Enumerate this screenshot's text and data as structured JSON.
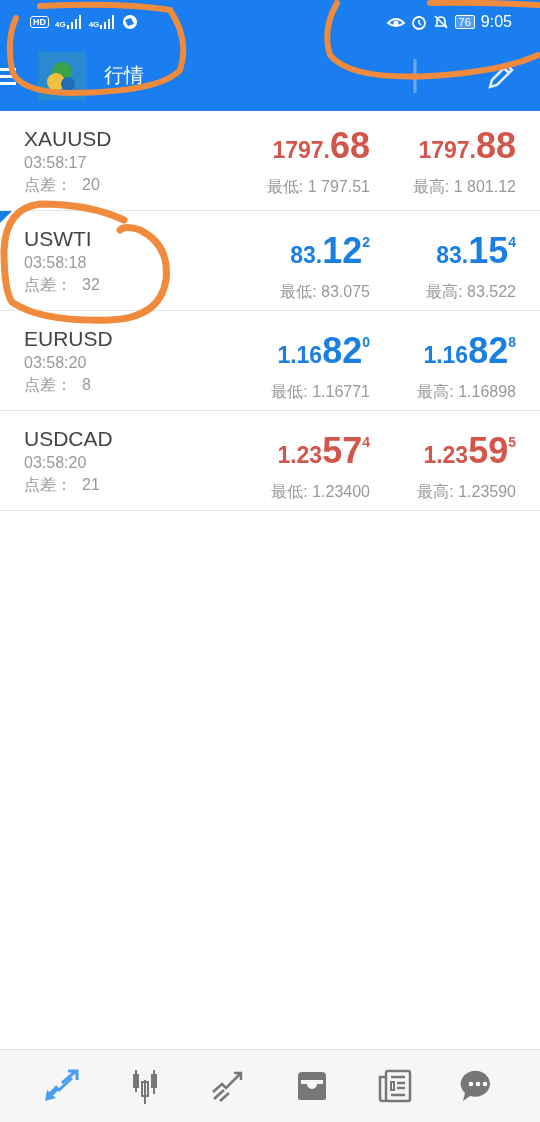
{
  "status_bar": {
    "hd_label": "HD",
    "networks": [
      "4G",
      "4G"
    ],
    "battery": "76",
    "time": "9:05"
  },
  "toolbar": {
    "title": "行情"
  },
  "quotes": [
    {
      "symbol": "XAUUSD",
      "time": "03:58:17",
      "spread_label": "点差：",
      "spread": "20",
      "color": "#d2574a",
      "selected": false,
      "bid": {
        "head": "1797.",
        "big": "68"
      },
      "ask": {
        "head": "1797.",
        "big": "88"
      },
      "low": "最低: 1 797.51",
      "high": "最高: 1 801.12"
    },
    {
      "symbol": "USWTI",
      "time": "03:58:18",
      "spread_label": "点差：",
      "spread": "32",
      "color": "#1a7fe3",
      "selected": true,
      "bid": {
        "head": "83.",
        "big": "12",
        "tail": "2"
      },
      "ask": {
        "head": "83.",
        "big": "15",
        "tail": "4"
      },
      "low": "最低: 83.075",
      "high": "最高: 83.522"
    },
    {
      "symbol": "EURUSD",
      "time": "03:58:20",
      "spread_label": "点差：",
      "spread": "8",
      "color": "#1a7fe3",
      "selected": false,
      "bid": {
        "head": "1.16",
        "big": "82",
        "tail": "0"
      },
      "ask": {
        "head": "1.16",
        "big": "82",
        "tail": "8"
      },
      "low": "最低: 1.16771",
      "high": "最高: 1.16898"
    },
    {
      "symbol": "USDCAD",
      "time": "03:58:20",
      "spread_label": "点差：",
      "spread": "21",
      "color": "#d2574a",
      "selected": false,
      "bid": {
        "head": "1.23",
        "big": "57",
        "tail": "4"
      },
      "ask": {
        "head": "1.23",
        "big": "59",
        "tail": "5"
      },
      "low": "最低: 1.23400",
      "high": "最高: 1.23590"
    }
  ],
  "nav": [
    {
      "kind": "quotes",
      "selected": true
    },
    {
      "kind": "chart",
      "selected": false
    },
    {
      "kind": "trade",
      "selected": false
    },
    {
      "kind": "history",
      "selected": false
    },
    {
      "kind": "news",
      "selected": false
    },
    {
      "kind": "chat",
      "selected": false
    }
  ]
}
